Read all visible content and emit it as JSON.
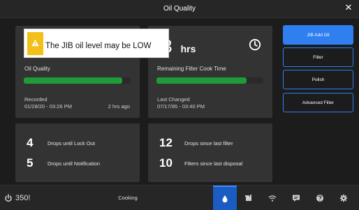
{
  "window": {
    "title": "Oil Quality",
    "close_glyph": "✕"
  },
  "oil_card": {
    "label": "Oil Quality",
    "level": 0.92,
    "bar_color": "#1f9b3a",
    "recorded_label": "Recorded",
    "recorded_time": "01/28/20 - 03:26 PM",
    "recorded_ago": "2 hrs ago"
  },
  "filter_card": {
    "hours_value": "3",
    "hours_prefix": ".",
    "hours_unit": "hrs",
    "label": "Remaining Filter Cook Time",
    "level": 0.84,
    "bar_color": "#1f9b3a",
    "changed_label": "Last Changed",
    "changed_time": "07/17/95 - 03:40 PM"
  },
  "drops_left": [
    {
      "value": "4",
      "label": "Drops until Lock Out"
    },
    {
      "value": "5",
      "label": "Drops until Notification"
    }
  ],
  "drops_right": [
    {
      "value": "12",
      "label": "Drops since last filter"
    },
    {
      "value": "10",
      "label": "Filters since last disposal"
    }
  ],
  "side_buttons": [
    {
      "label": "JIB Add Oil",
      "active": true
    },
    {
      "label": "Filter",
      "active": false
    },
    {
      "label": "Polish",
      "active": false
    },
    {
      "label": "Advanced Filter",
      "active": false
    }
  ],
  "tooltip": {
    "message": "The JIB oil level may be LOW"
  },
  "bottom": {
    "temperature": "350!",
    "status": "Cooking",
    "tabs": [
      {
        "icon": "oil-drop-icon",
        "active": true
      },
      {
        "icon": "fryer-icon",
        "active": false
      },
      {
        "icon": "wifi-icon",
        "active": false
      },
      {
        "icon": "chat-icon",
        "active": false
      },
      {
        "icon": "help-icon",
        "active": false
      },
      {
        "icon": "gear-icon",
        "active": false
      }
    ]
  },
  "colors": {
    "accent": "#2f7ff0",
    "warning": "#f3c01a",
    "card_bg": "#333333"
  }
}
